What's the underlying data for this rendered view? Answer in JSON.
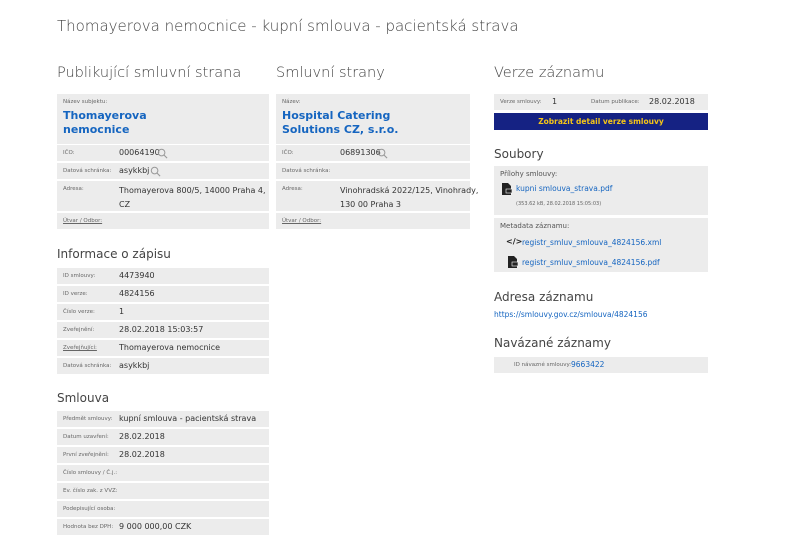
{
  "page_title": "Thomayerova nemocnice - kupní smlouva - pacientská strava",
  "publisher": {
    "heading": "Publikující smluvní strana",
    "name_label": "Název subjektu:",
    "name": "Thomayerova nemocnice",
    "name_line1": "Thomayerova",
    "name_line2": "nemocnice",
    "ico_label": "IČO:",
    "ico": "00064190",
    "box_label": "Datová schránka:",
    "box": "asykkbj",
    "address_label": "Adresa:",
    "address_line1": "Thomayerova 800/5, 14000 Praha 4,",
    "address_line2": "CZ",
    "unit_label": "Útvar / Odbor:"
  },
  "parties": {
    "heading": "Smluvní strany",
    "name_label": "Název:",
    "name_line1": "Hospital Catering",
    "name_line2": "Solutions CZ, s.r.o.",
    "ico_label": "IČO:",
    "ico": "06891306",
    "box_label": "Datová schránka:",
    "address_label": "Adresa:",
    "address_line1": "Vinohradská 2022/125, Vinohrady,",
    "address_line2": "130 00 Praha 3",
    "unit_label": "Útvar / Odbor:"
  },
  "registration": {
    "heading": "Informace o zápisu",
    "rows": [
      {
        "label": "ID smlouvy:",
        "value": "4473940"
      },
      {
        "label": "ID verze:",
        "value": "4824156"
      },
      {
        "label": "Číslo verze:",
        "value": "1"
      },
      {
        "label": "Zveřejnění:",
        "value": "28.02.2018 15:03:57"
      },
      {
        "label": "Zveřejňující:",
        "value": "Thomayerova nemocnice"
      },
      {
        "label": "Datová schránka:",
        "value": "asykkbj"
      }
    ]
  },
  "contract": {
    "heading": "Smlouva",
    "rows": [
      {
        "label": "Předmět smlouvy:",
        "value": "kupní smlouva - pacientská strava"
      },
      {
        "label": "Datum uzavření:",
        "value": "28.02.2018"
      },
      {
        "label": "První zveřejnění:",
        "value": "28.02.2018"
      },
      {
        "label": "Číslo smlouvy / Č.j.:",
        "value": ""
      },
      {
        "label": "Ev. číslo zak. z VVZ:",
        "value": ""
      },
      {
        "label": "Podepisující osoba:",
        "value": ""
      },
      {
        "label": "Hodnota bez DPH:",
        "value": "9 000 000,00 CZK"
      }
    ]
  },
  "version": {
    "heading": "Verze záznamu",
    "version_label": "Verze smlouvy:",
    "version_value": "1",
    "date_label": "Datum publikace:",
    "date_value": "28.02.2018",
    "detail_button": "Zobrazit detail verze smlouvy"
  },
  "files": {
    "heading": "Soubory",
    "attachments_label": "Přílohy smlouvy:",
    "attachment_name": "kupni smlouva_strava.pdf",
    "attachment_meta": "(353.62 kB, 28.02.2018 15:05:03)",
    "metadata_label": "Metadata záznamu:",
    "xml_name": "registr_smluv_smlouva_4824156.xml",
    "pdf_name": "registr_smluv_smlouva_4824156.pdf"
  },
  "address": {
    "heading": "Adresa záznamu",
    "url": "https://smlouvy.gov.cz/smlouva/4824156"
  },
  "linked": {
    "heading": "Navázané záznamy",
    "label": "ID návazné smlouvy:",
    "value": "9663422"
  },
  "colors": {
    "accent": "#1565c0",
    "button_bg": "#152283",
    "button_text": "#f5c518",
    "panel": "#ececec"
  }
}
